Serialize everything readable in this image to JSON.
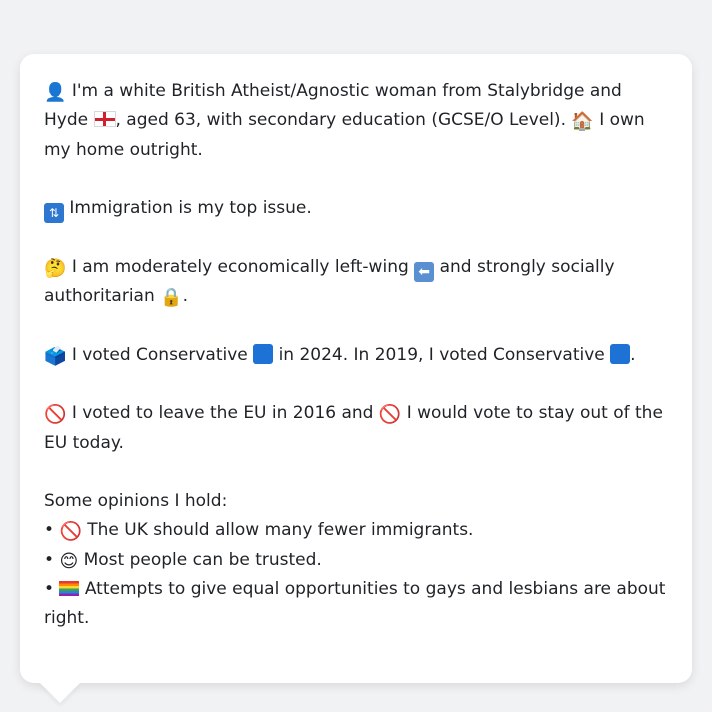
{
  "persona": {
    "intro_a": " I'm a white British Atheist/Agnostic woman from Stalybridge and Hyde ",
    "intro_b": ", aged 63, with secondary education (GCSE/O Level). ",
    "intro_c": " I own my home outright.",
    "top_issue": " Immigration is my top issue.",
    "ideology_a": " I am moderately economically left-wing ",
    "ideology_b": " and strongly socially authoritarian ",
    "ideology_c": ".",
    "vote_a": " I voted Conservative ",
    "vote_b": " in 2024. In 2019, I voted Conservative ",
    "vote_c": ".",
    "eu_a": " I voted to leave the EU in 2016 and ",
    "eu_b": " I would vote to stay out of the EU today.",
    "opinions_heading": "Some opinions I hold:",
    "opinions": [
      " The UK should allow many fewer immigrants.",
      " Most people can be trusted.",
      " Attempts to give equal opportunities to gays and lesbians are about right."
    ],
    "bullet": "•",
    "emoji": {
      "person": "👤",
      "house": "🏠",
      "passport": "🛂",
      "thinking": "🤔",
      "left_arrow": "⬅",
      "lock": "🔒",
      "ballot": "🗳️",
      "no_entry": "🚫",
      "smile": "😊"
    },
    "colors": {
      "conservative_blue": "#1e72d6",
      "bubble_bg": "#ffffff",
      "page_bg": "#f1f2f4"
    }
  }
}
